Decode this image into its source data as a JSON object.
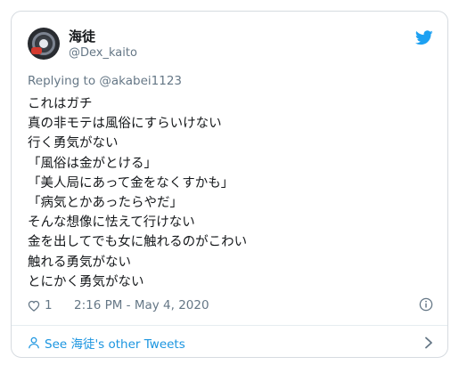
{
  "author": {
    "display_name": "海徒",
    "handle": "@Dex_kaito"
  },
  "reply": {
    "label": "Replying to @akabei1123"
  },
  "tweet": {
    "lines": [
      "これはガチ",
      "真の非モテは風俗にすらいけない",
      "行く勇気がない",
      "「風俗は金がとける」",
      "「美人局にあって金をなくすかも」",
      "「病気とかあったらやだ」",
      "そんな想像に怯えて行けない",
      "金を出してでも女に触れるのがこわい",
      "触れる勇気がない",
      "とにかく勇気がない"
    ]
  },
  "meta": {
    "like_count": "1",
    "timestamp": "2:16 PM - May 4, 2020"
  },
  "footer": {
    "see_label": "See 海徒's other Tweets"
  },
  "colors": {
    "brand": "#1da1f2",
    "link": "#1b95e0",
    "secondary_text": "#657786"
  },
  "icons": {
    "brand": "twitter-bird-icon",
    "like": "heart-icon",
    "info": "info-icon",
    "profile": "person-icon",
    "more": "chevron-right-icon"
  }
}
